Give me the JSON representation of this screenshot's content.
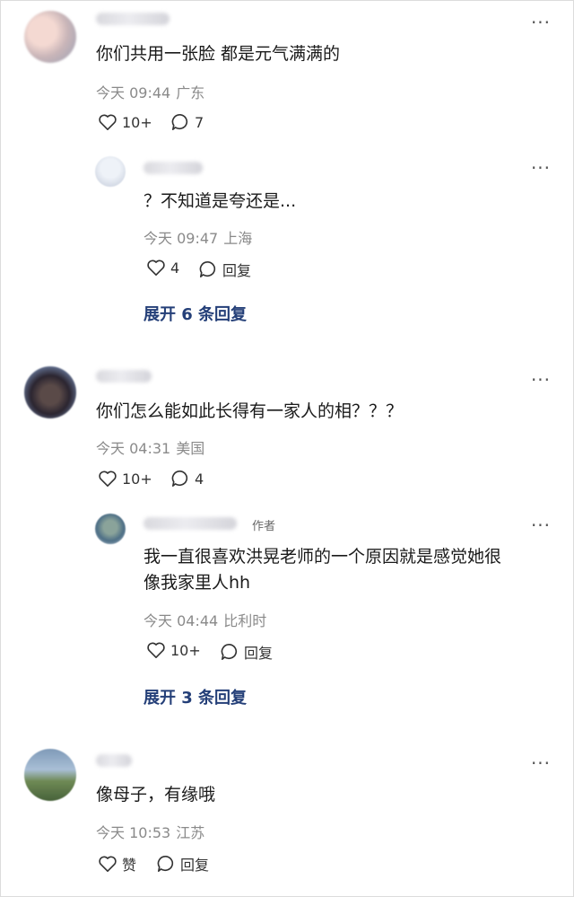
{
  "comments": [
    {
      "text": "你们共用一张脸 都是元气满满的",
      "time": "今天 09:44",
      "location": "广东",
      "likes": "10+",
      "replies": "7",
      "reply": {
        "text": "？不知道是夸还是...",
        "time": "今天 09:47",
        "location": "上海",
        "likes": "4",
        "reply_label": "回复"
      },
      "expand": "展开 6 条回复"
    },
    {
      "text": "你们怎么能如此长得有一家人的相？？？",
      "time": "今天 04:31",
      "location": "美国",
      "likes": "10+",
      "replies": "4",
      "reply": {
        "author_tag": "作者",
        "text_line1": "我一直很喜欢洪晃老师的一个原因就是感觉她很",
        "text_line2": "像我家里人hh",
        "time": "今天 04:44",
        "location": "比利时",
        "likes": "10+",
        "reply_label": "回复"
      },
      "expand": "展开 3 条回复"
    },
    {
      "text": "像母子，有缘哦",
      "time": "今天 10:53",
      "location": "江苏",
      "like_label": "赞",
      "reply_label": "回复"
    }
  ],
  "more_icon": "···",
  "icons": {
    "like": "heart-icon",
    "comment": "comment-bubble-icon",
    "more": "more-dots-icon"
  }
}
